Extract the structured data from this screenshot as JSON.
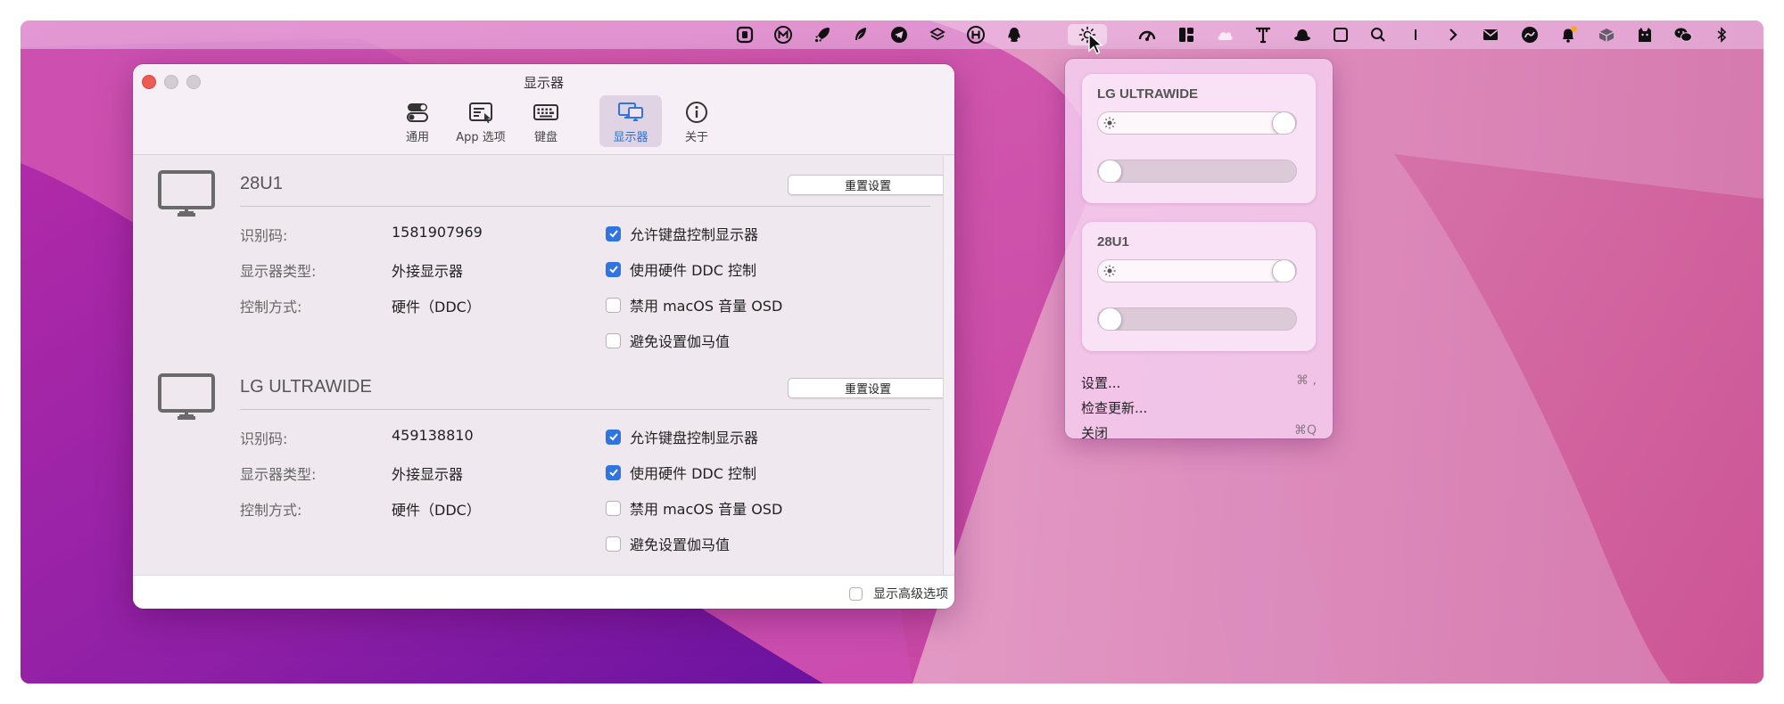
{
  "menubar": {
    "icons": [
      "square-app-icon",
      "m-circle-icon",
      "rocket-icon",
      "feather-icon",
      "telegram-icon",
      "layers-icon",
      "h-circle-icon",
      "qq-penguin-icon",
      "brightness-icon",
      "speedometer-icon",
      "layout-icon",
      "cloud-icon",
      "text-tool-icon",
      "hat-icon",
      "square-icon",
      "search-icon",
      "text-cursor-icon",
      "chevron-right-icon",
      "mail-icon",
      "gauge-icon",
      "bell-badge-icon",
      "box-icon",
      "cat-icon",
      "wechat-icon",
      "bluetooth-icon"
    ],
    "active_icon": "brightness-icon",
    "badge_color": "#f5a623"
  },
  "window": {
    "title": "显示器",
    "toolbar": [
      {
        "label": "通用",
        "icon": "toggles-icon"
      },
      {
        "label": "App 选项",
        "icon": "app-options-icon"
      },
      {
        "label": "键盘",
        "icon": "keyboard-icon"
      },
      {
        "label": "显示器",
        "icon": "displays-icon",
        "selected": true
      },
      {
        "label": "关于",
        "icon": "info-icon"
      }
    ],
    "accent": "#2f74e0",
    "displays": [
      {
        "name": "28U1",
        "reset_label": "重置设置",
        "id_label": "识别码:",
        "id_value": "1581907969",
        "type_label": "显示器类型:",
        "type_value": "外接显示器",
        "control_label": "控制方式:",
        "control_value": "硬件（DDC）",
        "options": [
          {
            "label": "允许键盘控制显示器",
            "checked": true
          },
          {
            "label": "使用硬件 DDC 控制",
            "checked": true
          },
          {
            "label": "禁用 macOS 音量 OSD",
            "checked": false
          },
          {
            "label": "避免设置伽马值",
            "checked": false
          }
        ]
      },
      {
        "name": "LG ULTRAWIDE",
        "reset_label": "重置设置",
        "id_label": "识别码:",
        "id_value": "459138810",
        "type_label": "显示器类型:",
        "type_value": "外接显示器",
        "control_label": "控制方式:",
        "control_value": "硬件（DDC）",
        "options": [
          {
            "label": "允许键盘控制显示器",
            "checked": true
          },
          {
            "label": "使用硬件 DDC 控制",
            "checked": true
          },
          {
            "label": "禁用 macOS 音量 OSD",
            "checked": false
          },
          {
            "label": "避免设置伽马值",
            "checked": false
          }
        ]
      }
    ],
    "footer": {
      "advanced_label": "显示高级选项",
      "advanced_checked": false
    }
  },
  "dropdown": {
    "cards": [
      {
        "title": "LG ULTRAWIDE",
        "brightness": 1.0,
        "volume": 0.0
      },
      {
        "title": "28U1",
        "brightness": 1.0,
        "volume": 0.0
      }
    ],
    "items": [
      {
        "label": "设置...",
        "shortcut": "⌘ ,"
      },
      {
        "label": "检查更新...",
        "shortcut": ""
      },
      {
        "label": "关闭",
        "shortcut": "⌘Q"
      }
    ]
  }
}
